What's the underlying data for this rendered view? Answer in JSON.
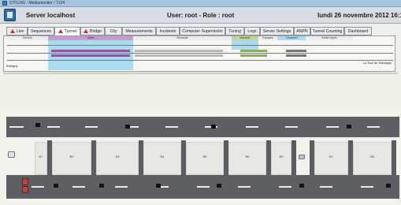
{
  "window": {
    "title": "CITILOG - Mediamonitor / T124"
  },
  "header": {
    "server": "Server localhost",
    "user": "User: root - Role : root",
    "datetime": "lundi 26 novembre 2012 16:14:2"
  },
  "tabs": [
    {
      "label": "Live",
      "warn": true
    },
    {
      "label": "Sequences",
      "warn": false
    },
    {
      "label": "Tunnel",
      "warn": true,
      "active": true
    },
    {
      "label": "Bridge",
      "warn": true
    },
    {
      "label": "City",
      "warn": false
    },
    {
      "label": "Measurements",
      "warn": false
    },
    {
      "label": "Incidents",
      "warn": false
    },
    {
      "label": "Computer Supervision",
      "warn": false
    },
    {
      "label": "Tuning",
      "warn": false
    },
    {
      "label": "Logs",
      "warn": false
    },
    {
      "label": "Server Settings",
      "warn": false
    },
    {
      "label": "ANPR",
      "warn": false
    },
    {
      "label": "Tunnel Counting",
      "warn": false
    },
    {
      "label": "Dashboard",
      "warn": false
    }
  ],
  "schematic": {
    "zones": [
      "Service",
      "Vallée",
      "Brocante",
      "Marches",
      "Escapes",
      "Chabanel",
      "Sortie Inpuls"
    ],
    "left_label": "Bobigny",
    "right_label": "La Tour de Salvagny"
  },
  "map": {
    "cells": [
      "B7",
      "B2",
      "B3",
      "B4",
      "B5",
      "B6",
      "B9",
      "B7",
      "B8"
    ]
  },
  "colors": {
    "highlight_blue": "#a9dcf3",
    "highlight_purple": "#c79acb",
    "highlight_green": "#bfd78f",
    "road": "#5d5f62"
  }
}
